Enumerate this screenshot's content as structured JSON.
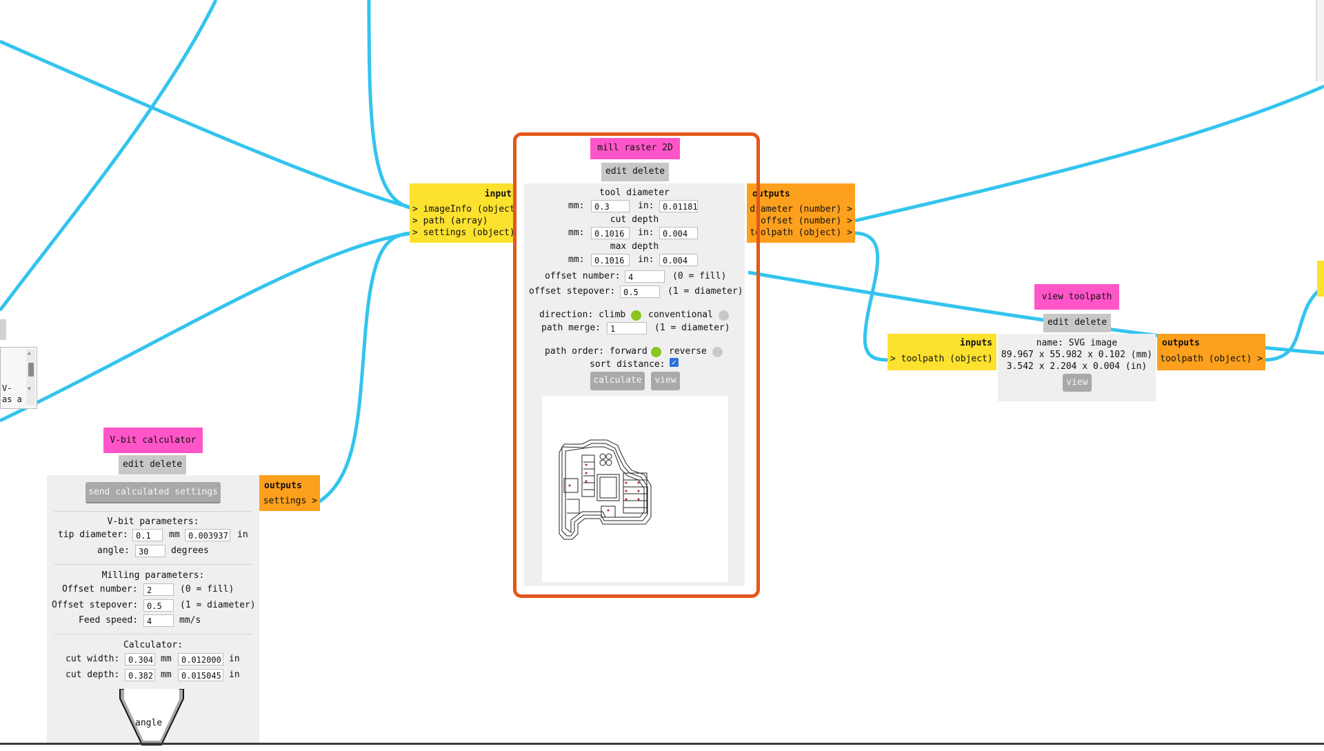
{
  "mill_raster": {
    "title": "mill raster 2D",
    "edit_delete": "edit delete",
    "inputs": {
      "label": "input",
      "items": [
        "> imageInfo (object",
        "> path (array)",
        "> settings (object)"
      ]
    },
    "outputs": {
      "label": "outputs",
      "items": [
        "diameter (number) >",
        "offset (number) >",
        "toolpath (object) >"
      ]
    },
    "tool_diameter": {
      "label": "tool diameter",
      "mm_label": "mm:",
      "mm": "0.3",
      "in_label": "in:",
      "in": "0.01181"
    },
    "cut_depth": {
      "label": "cut depth",
      "mm_label": "mm:",
      "mm": "0.1016",
      "in_label": "in:",
      "in": "0.004"
    },
    "max_depth": {
      "label": "max depth",
      "mm_label": "mm:",
      "mm": "0.1016",
      "in_label": "in:",
      "in": "0.004"
    },
    "offset_number": {
      "label": "offset number:",
      "value": "4",
      "hint": "(0 = fill)"
    },
    "offset_stepover": {
      "label": "offset stepover:",
      "value": "0.5",
      "hint": "(1 = diameter)"
    },
    "direction": {
      "label": "direction: climb",
      "alt": "conventional"
    },
    "path_merge": {
      "label": "path merge:",
      "value": "1",
      "hint": "(1 = diameter)"
    },
    "path_order": {
      "label": "path order: forward",
      "alt": "reverse"
    },
    "sort_distance": {
      "label": "sort distance:",
      "checked": true
    },
    "calculate": "calculate",
    "view": "view"
  },
  "view_toolpath": {
    "title": "view toolpath",
    "edit_delete": "edit delete",
    "inputs_label": "inputs",
    "input_item": "> toolpath (object)",
    "outputs_label": "outputs",
    "output_item": "toolpath (object) >",
    "name": "name: SVG image",
    "size_mm": "89.967 x 55.982 x 0.102 (mm)",
    "size_in": "3.542 x 2.204 x 0.004 (in)",
    "view": "view"
  },
  "vbit": {
    "title": "V-bit calculator",
    "edit_delete": "edit delete",
    "send": "send calculated settings",
    "outputs_label": "outputs",
    "output_item": "settings >",
    "vbit_params": "V-bit parameters:",
    "tip_label": "tip diameter:",
    "tip_mm": "0.1",
    "mm": "mm",
    "tip_in": "0.003937",
    "in": "in",
    "angle_label": "angle:",
    "angle": "30",
    "degrees": "degrees",
    "milling_params": "Milling parameters:",
    "offset_number_label": "Offset number:",
    "offset_number": "2",
    "fill_hint": "(0 = fill)",
    "offset_stepover_label": "Offset stepover:",
    "offset_stepover": "0.5",
    "diameter_hint": "(1 = diameter)",
    "feed_label": "Feed speed:",
    "feed": "4",
    "feed_unit": "mm/s",
    "calculator": "Calculator:",
    "cut_width_label": "cut width:",
    "cut_width_mm": "0.304",
    "cut_width_in": "0.012000",
    "cut_depth_label": "cut depth:",
    "cut_depth_mm": "0.382",
    "cut_depth_in": "0.015045",
    "diagram_label": "angle"
  },
  "left_textarea": {
    "line1": "V-",
    "line2": "as a"
  },
  "colors": {
    "wire": "#33c4ee",
    "title": "#ff55c8",
    "inputs": "#fce12e",
    "outputs": "#fda01d",
    "highlight": "#e3571b",
    "radio_on": "#8ac61c"
  }
}
